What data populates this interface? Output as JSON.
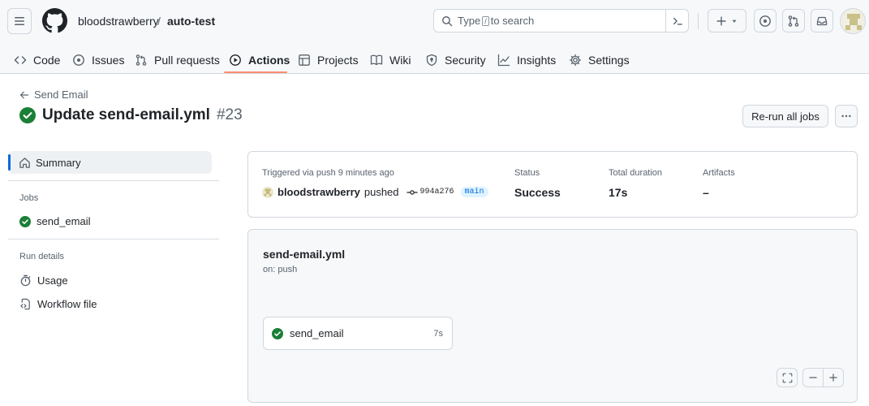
{
  "header": {
    "owner": "bloodstrawberry",
    "separator": "/",
    "repo": "auto-test",
    "search_placeholder_before": "Type",
    "search_placeholder_key": "/",
    "search_placeholder_after": "to search"
  },
  "repo_nav": [
    {
      "label": "Code",
      "icon": "code-icon"
    },
    {
      "label": "Issues",
      "icon": "issue-opened-icon"
    },
    {
      "label": "Pull requests",
      "icon": "git-pull-request-icon"
    },
    {
      "label": "Actions",
      "icon": "play-icon",
      "active": true
    },
    {
      "label": "Projects",
      "icon": "table-icon"
    },
    {
      "label": "Wiki",
      "icon": "book-icon"
    },
    {
      "label": "Security",
      "icon": "shield-icon"
    },
    {
      "label": "Insights",
      "icon": "graph-icon"
    },
    {
      "label": "Settings",
      "icon": "gear-icon"
    }
  ],
  "run": {
    "back_label": "Send Email",
    "title": "Update send-email.yml",
    "number": "#23",
    "rerun_label": "Re-run all jobs"
  },
  "sidebar": {
    "summary_label": "Summary",
    "jobs_heading": "Jobs",
    "jobs": [
      {
        "label": "send_email"
      }
    ],
    "run_details_heading": "Run details",
    "details": [
      {
        "label": "Usage",
        "icon": "stopwatch-icon"
      },
      {
        "label": "Workflow file",
        "icon": "file-code-icon"
      }
    ]
  },
  "info": {
    "triggered_label": "Triggered via push 9 minutes ago",
    "user": "bloodstrawberry",
    "action": "pushed",
    "sha": "994a276",
    "branch": "main",
    "status_label": "Status",
    "status_value": "Success",
    "duration_label": "Total duration",
    "duration_value": "17s",
    "artifacts_label": "Artifacts",
    "artifacts_value": "–"
  },
  "graph": {
    "workflow_name": "send-email.yml",
    "trigger": "on: push",
    "job_name": "send_email",
    "job_duration": "7s"
  },
  "colors": {
    "success": "#1a7f37",
    "accent": "#0969da",
    "active_tab_underline": "#fd8c73"
  }
}
